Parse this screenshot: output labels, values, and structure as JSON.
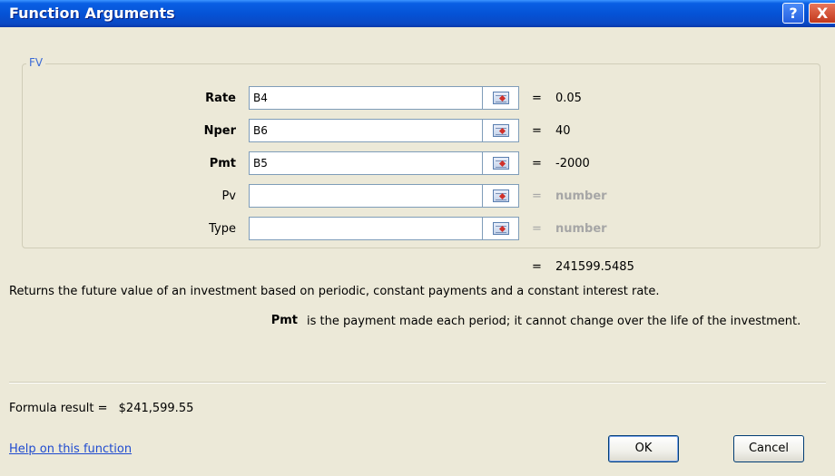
{
  "dialog": {
    "title": "Function Arguments",
    "help_symbol": "?",
    "close_symbol": "X"
  },
  "function": {
    "name": "FV",
    "arguments": [
      {
        "label": "Rate",
        "value": "B4",
        "result": "0.05",
        "required": true,
        "placeholder": false
      },
      {
        "label": "Nper",
        "value": "B6",
        "result": "40",
        "required": true,
        "placeholder": false
      },
      {
        "label": "Pmt",
        "value": "B5",
        "result": "-2000",
        "required": true,
        "placeholder": false
      },
      {
        "label": "Pv",
        "value": "",
        "result": "number",
        "required": false,
        "placeholder": true
      },
      {
        "label": "Type",
        "value": "",
        "result": "number",
        "required": false,
        "placeholder": true
      }
    ],
    "equals_symbol": "=",
    "overall_result": "241599.5485",
    "description": "Returns the future value of an investment based on periodic, constant payments and a constant interest rate.",
    "arg_help_name": "Pmt",
    "arg_help_text": "is the payment made each period; it cannot change over the life of the investment."
  },
  "footer": {
    "formula_result_label": "Formula result =",
    "formula_result_value": "$241,599.55",
    "help_link": "Help on this function",
    "ok_label": "OK",
    "cancel_label": "Cancel"
  },
  "colors": {
    "titlebar": "#0553d6",
    "dialog_bg": "#ece9d8",
    "link": "#1f4bd0",
    "placeholder": "#a6a6a6"
  }
}
